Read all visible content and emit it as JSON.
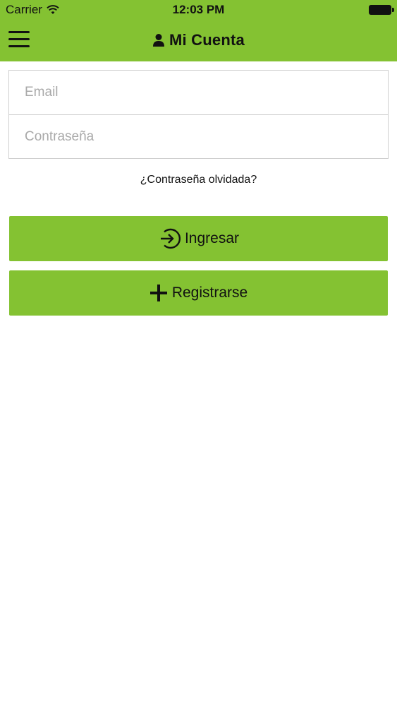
{
  "status_bar": {
    "carrier": "Carrier",
    "time": "12:03 PM"
  },
  "header": {
    "title": "Mi Cuenta",
    "icons": [
      "menu-icon",
      "user-icon"
    ],
    "background_color": "#84c232"
  },
  "form": {
    "email_placeholder": "Email",
    "email_value": "",
    "password_placeholder": "Contraseña",
    "password_value": ""
  },
  "forgot_password_label": "¿Contraseña olvidada?",
  "buttons": {
    "login_label": "Ingresar",
    "login_icon": "login-arrow-icon",
    "register_label": "Registrarse",
    "register_icon": "plus-icon",
    "color": "#84c232"
  }
}
